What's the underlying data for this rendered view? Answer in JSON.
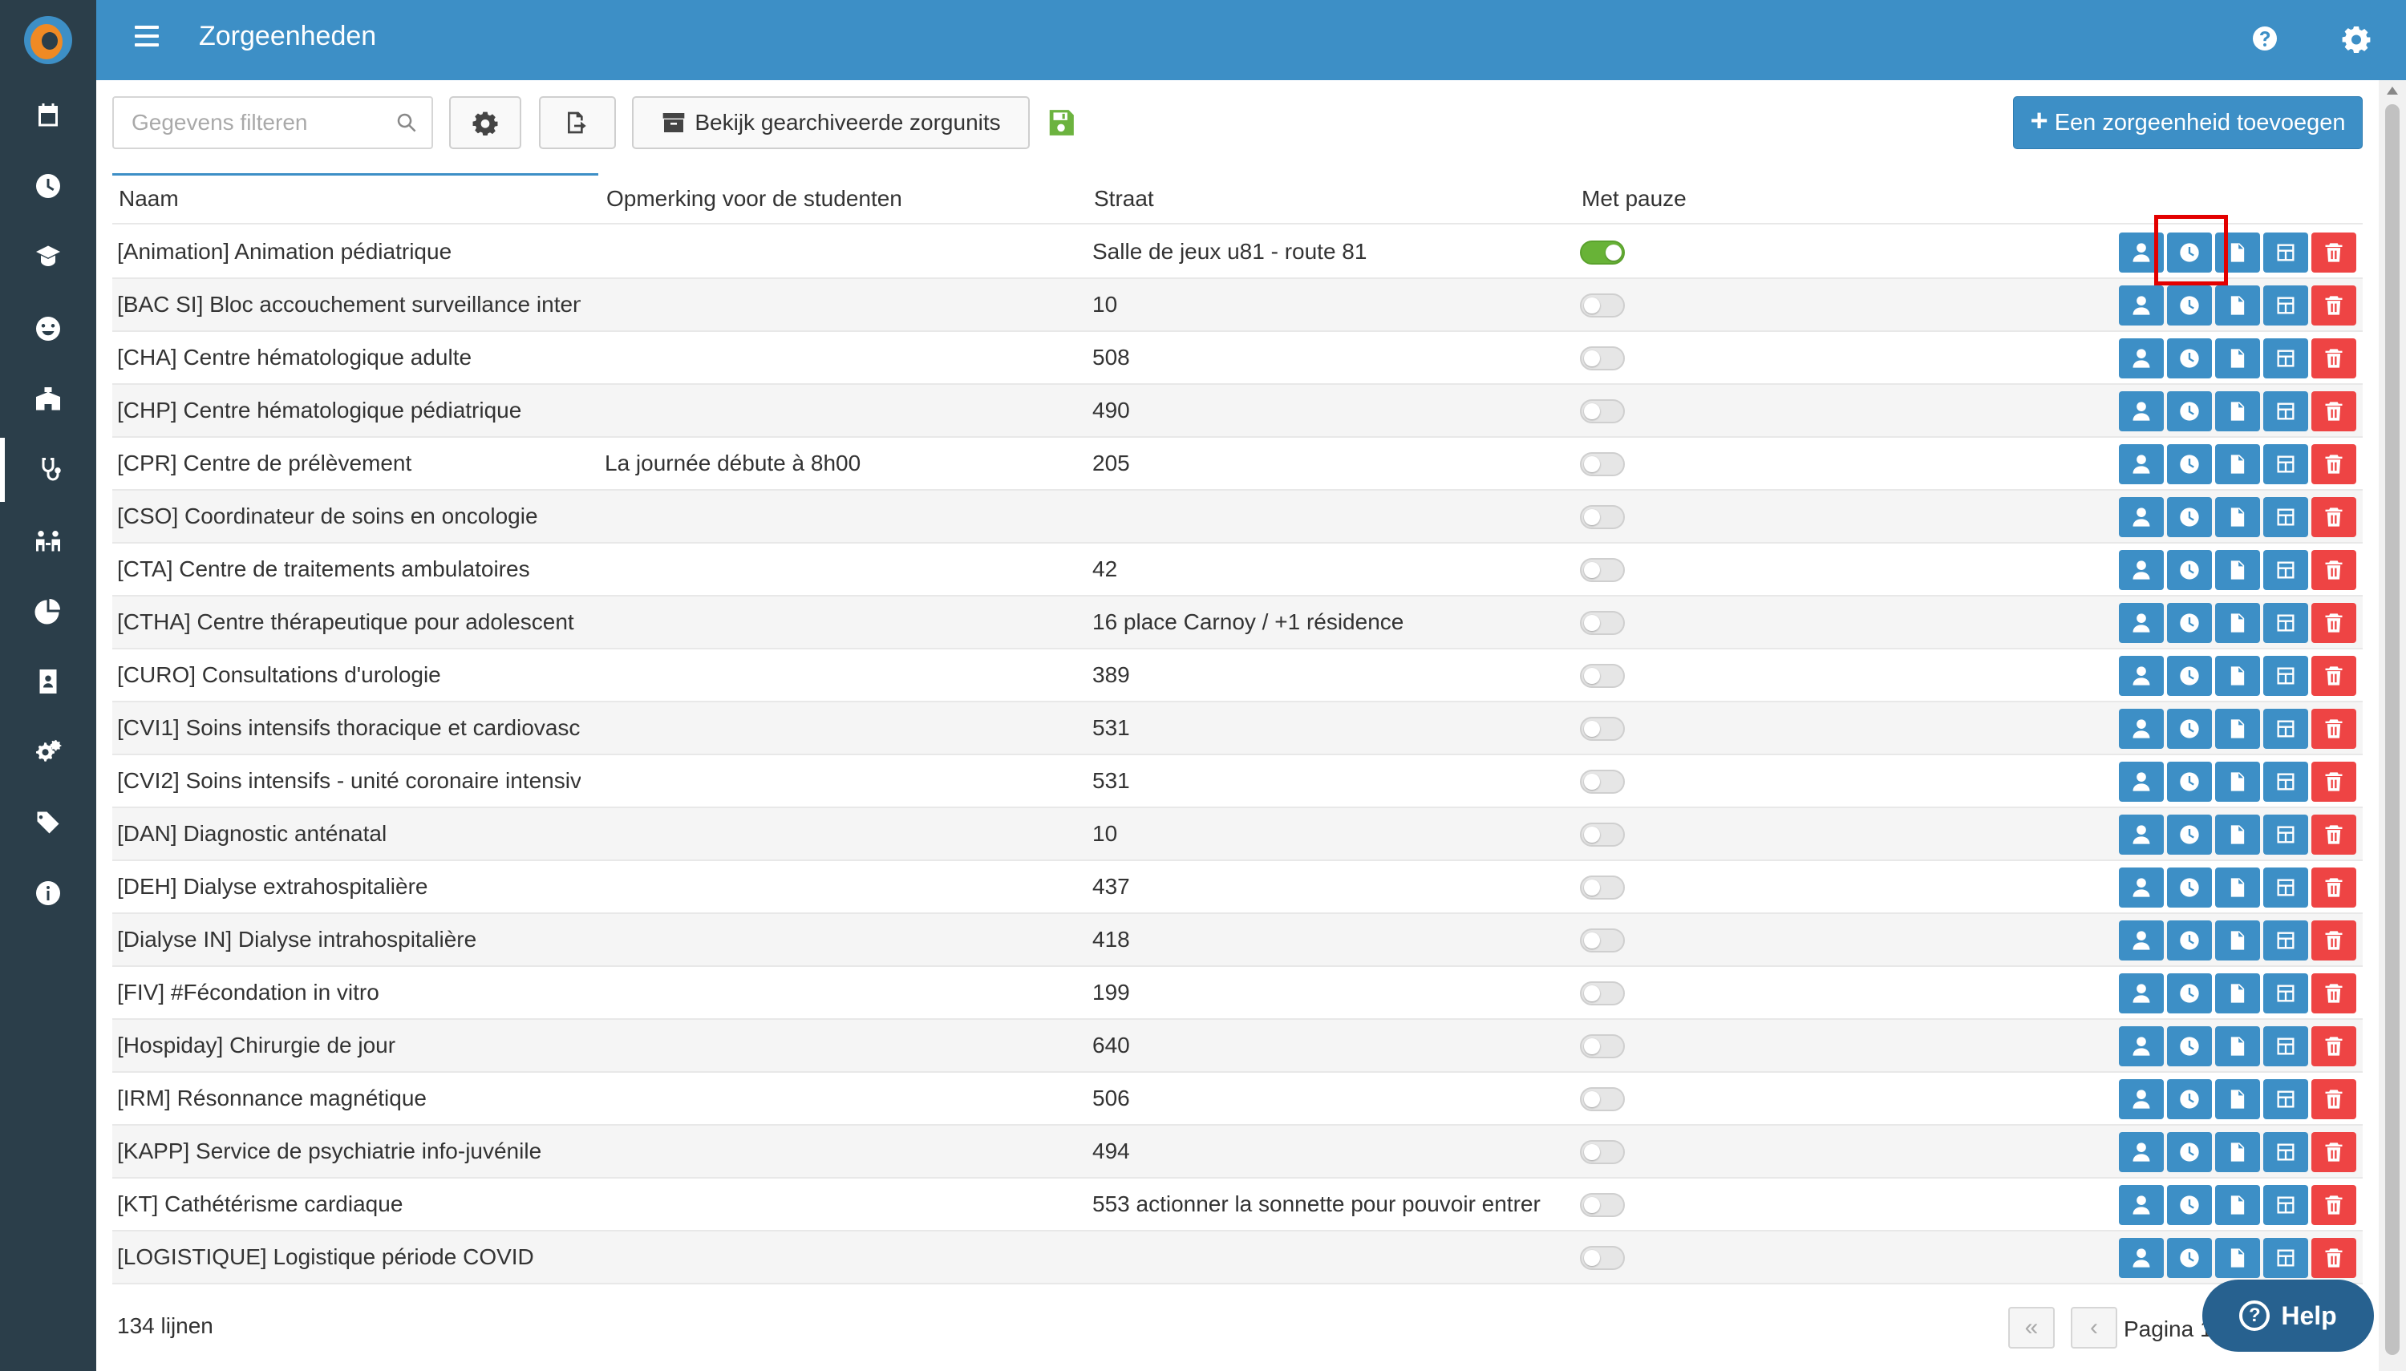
{
  "header": {
    "title": "Zorgeenheden"
  },
  "toolbar": {
    "filter_placeholder": "Gegevens filteren",
    "archived_label": "Bekijk gearchiveerde zorgunits",
    "add_label": "Een zorgeenheid toevoegen"
  },
  "sidebar": {
    "items": [
      "calendar-icon",
      "clock-icon",
      "graduation-cap-icon",
      "smile-icon",
      "hospital-icon",
      "stethoscope-icon",
      "people-icon",
      "pie-chart-icon",
      "id-card-icon",
      "gears-icon",
      "tags-icon",
      "info-icon"
    ],
    "active_index": 5
  },
  "table": {
    "headers": {
      "naam": "Naam",
      "opmerking": "Opmerking voor de studenten",
      "straat": "Straat",
      "pauze": "Met pauze"
    },
    "rows": [
      {
        "naam": "[Animation] Animation pédiatrique",
        "opmerking": "",
        "straat": "Salle de jeux u81 - route 81",
        "pauze": true
      },
      {
        "naam": "[BAC SI] Bloc accouchement surveillance inten",
        "opmerking": "",
        "straat": "10",
        "pauze": false
      },
      {
        "naam": "[CHA] Centre hématologique adulte",
        "opmerking": "",
        "straat": "508",
        "pauze": false
      },
      {
        "naam": "[CHP] Centre hématologique pédiatrique",
        "opmerking": "",
        "straat": "490",
        "pauze": false
      },
      {
        "naam": "[CPR] Centre de prélèvement",
        "opmerking": "La journée débute à 8h00",
        "straat": "205",
        "pauze": false
      },
      {
        "naam": "[CSO] Coordinateur de soins en oncologie",
        "opmerking": "",
        "straat": "",
        "pauze": false
      },
      {
        "naam": "[CTA] Centre de traitements ambulatoires",
        "opmerking": "",
        "straat": "42",
        "pauze": false
      },
      {
        "naam": "[CTHA] Centre thérapeutique pour adolescent",
        "opmerking": "",
        "straat": "16 place Carnoy / +1 résidence",
        "pauze": false
      },
      {
        "naam": "[CURO] Consultations d'urologie",
        "opmerking": "",
        "straat": "389",
        "pauze": false
      },
      {
        "naam": "[CVI1]  Soins intensifs thoracique et cardiovasc",
        "opmerking": "",
        "straat": "531",
        "pauze": false
      },
      {
        "naam": "[CVI2] Soins intensifs - unité coronaire intensiv",
        "opmerking": "",
        "straat": "531",
        "pauze": false
      },
      {
        "naam": "[DAN] Diagnostic anténatal",
        "opmerking": "",
        "straat": "10",
        "pauze": false
      },
      {
        "naam": "[DEH] Dialyse extrahospitalière",
        "opmerking": "",
        "straat": "437",
        "pauze": false
      },
      {
        "naam": "[Dialyse IN] Dialyse intrahospitalière",
        "opmerking": "",
        "straat": "418",
        "pauze": false
      },
      {
        "naam": "[FIV]  #Fécondation in vitro",
        "opmerking": "",
        "straat": "199",
        "pauze": false
      },
      {
        "naam": "[Hospiday] Chirurgie de jour",
        "opmerking": "",
        "straat": "640",
        "pauze": false
      },
      {
        "naam": "[IRM] Résonnance magnétique",
        "opmerking": "",
        "straat": "506",
        "pauze": false
      },
      {
        "naam": "[KAPP] Service de psychiatrie info-juvénile",
        "opmerking": "",
        "straat": "494",
        "pauze": false
      },
      {
        "naam": "[KT] Cathétérisme cardiaque",
        "opmerking": "",
        "straat": "553 actionner la sonnette pour pouvoir entrer",
        "pauze": false
      },
      {
        "naam": "[LOGISTIQUE] Logistique période COVID",
        "opmerking": "",
        "straat": "",
        "pauze": false
      }
    ]
  },
  "footer": {
    "count": "134 lijnen",
    "pagina": "Pagina 1",
    "help_label": "Help"
  },
  "colors": {
    "primary": "#3d8fc6",
    "sidebar": "#2b3e4a",
    "danger": "#ee4444",
    "success": "#68b337"
  }
}
